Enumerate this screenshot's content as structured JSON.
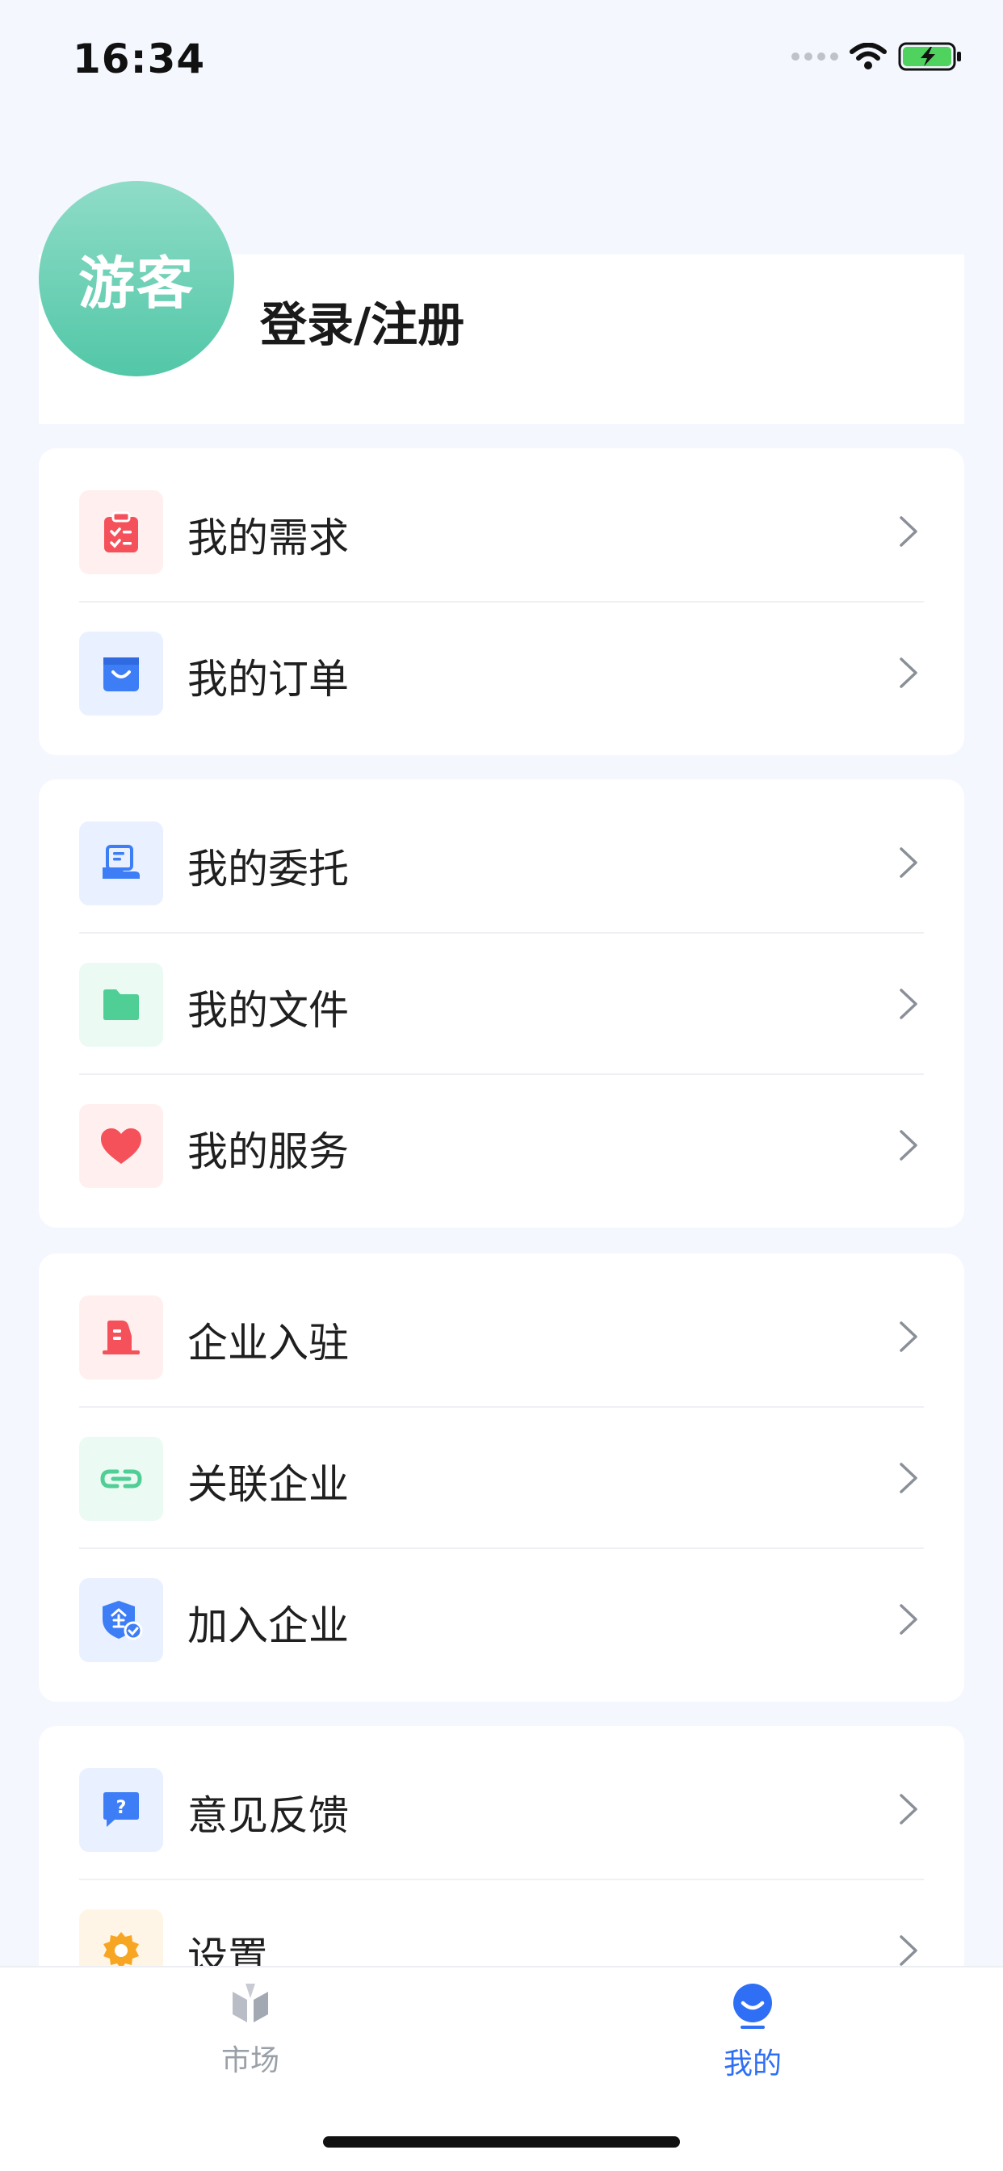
{
  "status": {
    "time": "16:34"
  },
  "profile": {
    "avatar_text": "游客",
    "login_label": "登录/注册"
  },
  "groups": [
    {
      "items": [
        {
          "label": "我的需求",
          "icon": "clipboard-icon"
        },
        {
          "label": "我的订单",
          "icon": "shopping-bag-icon"
        }
      ]
    },
    {
      "items": [
        {
          "label": "我的委托",
          "icon": "entrust-icon"
        },
        {
          "label": "我的文件",
          "icon": "folder-icon"
        },
        {
          "label": "我的服务",
          "icon": "heart-icon"
        }
      ]
    },
    {
      "items": [
        {
          "label": "企业入驻",
          "icon": "building-icon"
        },
        {
          "label": "关联企业",
          "icon": "link-icon"
        },
        {
          "label": "加入企业",
          "icon": "enterprise-shield-icon"
        }
      ]
    },
    {
      "items": [
        {
          "label": "意见反馈",
          "icon": "feedback-icon"
        },
        {
          "label": "设置",
          "icon": "gear-icon"
        }
      ]
    }
  ],
  "tabbar": {
    "tabs": [
      {
        "label": "市场",
        "icon": "market-icon",
        "active": false
      },
      {
        "label": "我的",
        "icon": "profile-face-icon",
        "active": true
      }
    ]
  },
  "colors": {
    "active_tab": "#2f6ff5",
    "inactive_tab": "#9aa0a8",
    "red": "#f5515a",
    "blue": "#3d7ef6",
    "green": "#4fcf95",
    "orange": "#f7a623"
  }
}
